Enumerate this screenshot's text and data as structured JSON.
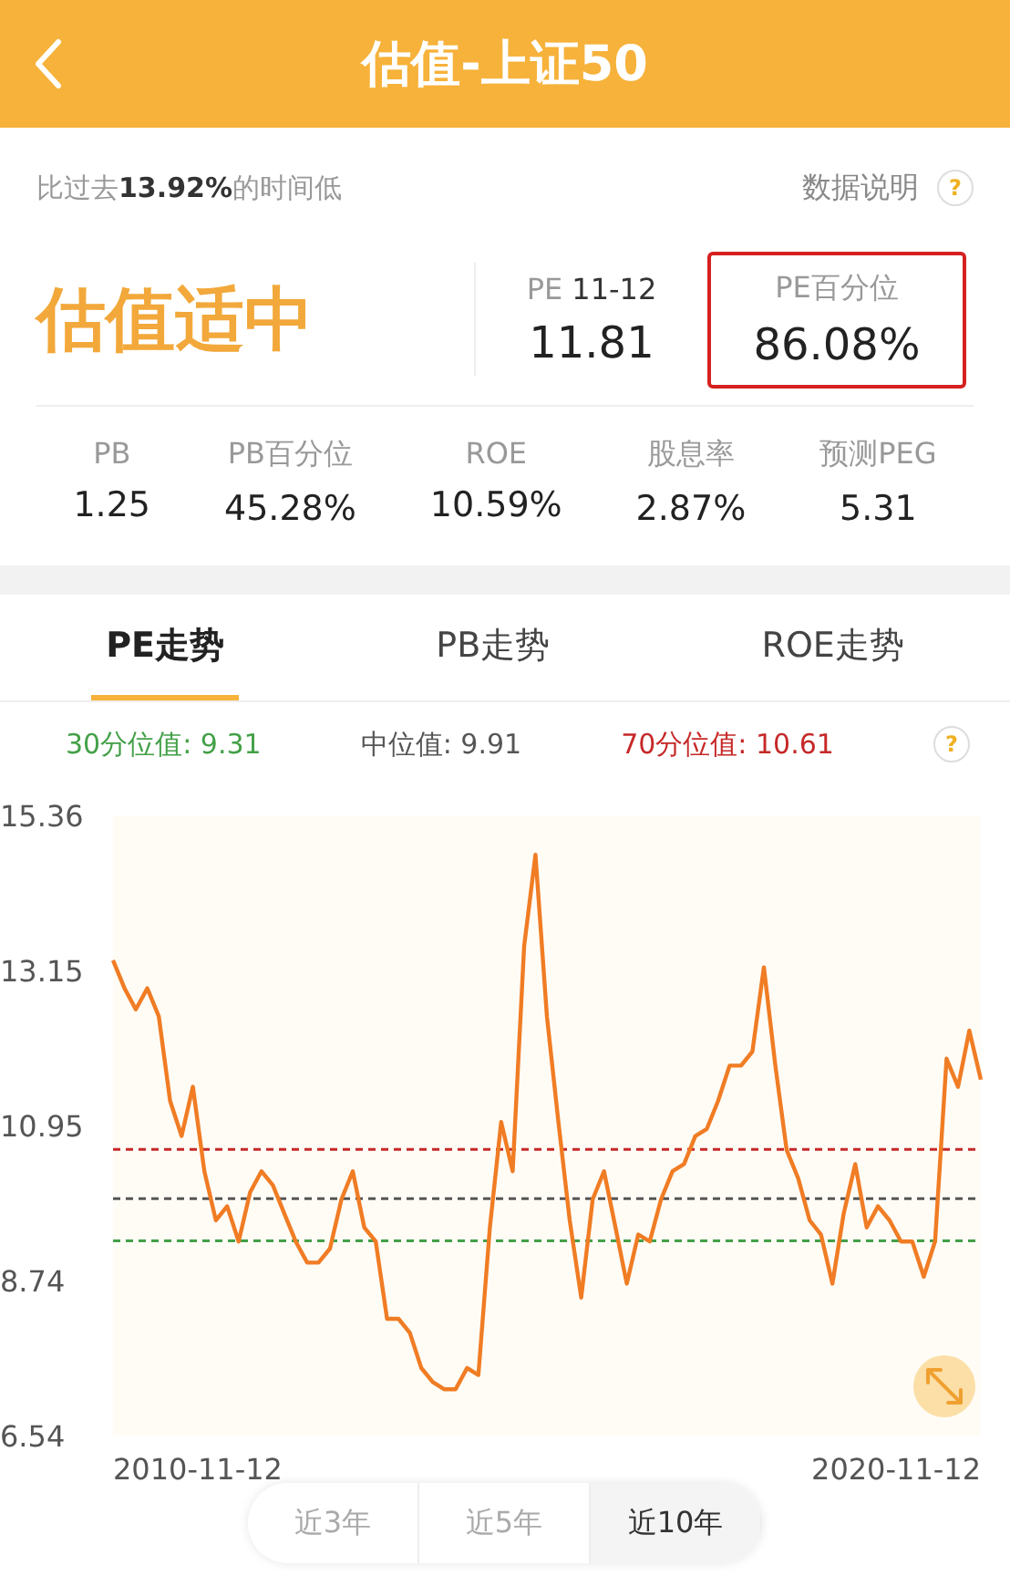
{
  "header": {
    "title": "估值-上证50"
  },
  "summary": {
    "note": "比过去**13.92%**的时间低",
    "help_link": "数据说明",
    "help_icon": "?",
    "verdict": "估值适中",
    "pe": {
      "label": "PE",
      "date": "11-12",
      "value": "11.81"
    },
    "pe_percentile": {
      "label": "PE百分位",
      "value": "86.08%",
      "highlighted": true
    }
  },
  "metrics": [
    {
      "label": "PB",
      "value": "1.25"
    },
    {
      "label": "PB百分位",
      "value": "45.28%"
    },
    {
      "label": "ROE",
      "value": "10.59%"
    },
    {
      "label": "股息率",
      "value": "2.87%"
    },
    {
      "label": "预测PEG",
      "value": "5.31"
    }
  ],
  "tabs": [
    {
      "label": "PE走势",
      "selected": true
    },
    {
      "label": "PB走势",
      "selected": false
    },
    {
      "label": "ROE走势",
      "selected": false
    }
  ],
  "legend": [
    {
      "value": "9.31"
    },
    {
      "value": "9.91"
    },
    {
      "value": "10.61"
    }
  ],
  "legend_help": "?",
  "chart_data": {
    "type": "line",
    "ylim": [
      6.54,
      15.36
    ],
    "yticks": [
      6.54,
      8.74,
      10.95,
      13.15,
      15.36
    ],
    "series": [
      {
        "name": "30分位值:",
        "color": "#43a047",
        "line_style": "dashed",
        "values": [
          9.31,
          9.31,
          9.31,
          9.31,
          9.31,
          9.31,
          9.31,
          9.31,
          9.31,
          9.31,
          9.31,
          9.31,
          9.31,
          9.31,
          9.31,
          9.31,
          9.31,
          9.31,
          9.31,
          9.31,
          9.31,
          9.31,
          9.31,
          9.31,
          9.31,
          9.31,
          9.31,
          9.31,
          9.31,
          9.31,
          9.31,
          9.31,
          9.31,
          9.31,
          9.31,
          9.31,
          9.31,
          9.31,
          9.31,
          9.31,
          9.31,
          9.31,
          9.31,
          9.31,
          9.31,
          9.31,
          9.31,
          9.31,
          9.31,
          9.31,
          9.31,
          9.31,
          9.31,
          9.31,
          9.31,
          9.31,
          9.31,
          9.31,
          9.31,
          9.31,
          9.31,
          9.31,
          9.31,
          9.31,
          9.31,
          9.31,
          9.31,
          9.31,
          9.31,
          9.31,
          9.31,
          9.31,
          9.31,
          9.31,
          9.31,
          9.31,
          9.31
        ]
      },
      {
        "name": "中位值:",
        "color": "#555555",
        "line_style": "dashed",
        "values": [
          9.91,
          9.91,
          9.91,
          9.91,
          9.91,
          9.91,
          9.91,
          9.91,
          9.91,
          9.91,
          9.91,
          9.91,
          9.91,
          9.91,
          9.91,
          9.91,
          9.91,
          9.91,
          9.91,
          9.91,
          9.91,
          9.91,
          9.91,
          9.91,
          9.91,
          9.91,
          9.91,
          9.91,
          9.91,
          9.91,
          9.91,
          9.91,
          9.91,
          9.91,
          9.91,
          9.91,
          9.91,
          9.91,
          9.91,
          9.91,
          9.91,
          9.91,
          9.91,
          9.91,
          9.91,
          9.91,
          9.91,
          9.91,
          9.91,
          9.91,
          9.91,
          9.91,
          9.91,
          9.91,
          9.91,
          9.91,
          9.91,
          9.91,
          9.91,
          9.91,
          9.91,
          9.91,
          9.91,
          9.91,
          9.91,
          9.91,
          9.91,
          9.91,
          9.91,
          9.91,
          9.91,
          9.91,
          9.91,
          9.91,
          9.91,
          9.91,
          9.91
        ]
      },
      {
        "name": "70分位值:",
        "color": "#c62828",
        "line_style": "dashed",
        "values": [
          10.61,
          10.61,
          10.61,
          10.61,
          10.61,
          10.61,
          10.61,
          10.61,
          10.61,
          10.61,
          10.61,
          10.61,
          10.61,
          10.61,
          10.61,
          10.61,
          10.61,
          10.61,
          10.61,
          10.61,
          10.61,
          10.61,
          10.61,
          10.61,
          10.61,
          10.61,
          10.61,
          10.61,
          10.61,
          10.61,
          10.61,
          10.61,
          10.61,
          10.61,
          10.61,
          10.61,
          10.61,
          10.61,
          10.61,
          10.61,
          10.61,
          10.61,
          10.61,
          10.61,
          10.61,
          10.61,
          10.61,
          10.61,
          10.61,
          10.61,
          10.61,
          10.61,
          10.61,
          10.61,
          10.61,
          10.61,
          10.61,
          10.61,
          10.61,
          10.61,
          10.61,
          10.61,
          10.61,
          10.61,
          10.61,
          10.61,
          10.61,
          10.61,
          10.61,
          10.61,
          10.61,
          10.61,
          10.61,
          10.61,
          10.61,
          10.61,
          10.61
        ]
      },
      {
        "color": "#f07c24",
        "line_style": "solid",
        "values": [
          13.3,
          12.9,
          12.6,
          12.9,
          12.5,
          11.3,
          10.8,
          11.5,
          10.3,
          9.6,
          9.8,
          9.3,
          10.0,
          10.3,
          10.1,
          9.7,
          9.3,
          9.0,
          9.0,
          9.2,
          9.9,
          10.3,
          9.5,
          9.3,
          8.2,
          8.2,
          8.0,
          7.5,
          7.3,
          7.2,
          7.2,
          7.5,
          7.4,
          9.5,
          11.0,
          10.3,
          13.5,
          14.8,
          12.5,
          11.0,
          9.6,
          8.5,
          9.9,
          10.3,
          9.5,
          8.7,
          9.4,
          9.3,
          9.9,
          10.3,
          10.4,
          10.8,
          10.9,
          11.3,
          11.8,
          11.8,
          12.0,
          13.2,
          11.8,
          10.6,
          10.2,
          9.6,
          9.4,
          8.7,
          9.7,
          10.4,
          9.5,
          9.8,
          9.6,
          9.3,
          9.3,
          8.8,
          9.3,
          11.9,
          11.5,
          12.3,
          11.6
        ]
      }
    ]
  },
  "x_axis": {
    "start": "2010-11-12",
    "end": "2020-11-12"
  },
  "ranges": [
    {
      "label": "近3年",
      "selected": false
    },
    {
      "label": "近5年",
      "selected": false
    },
    {
      "label": "近10年",
      "selected": true
    }
  ]
}
